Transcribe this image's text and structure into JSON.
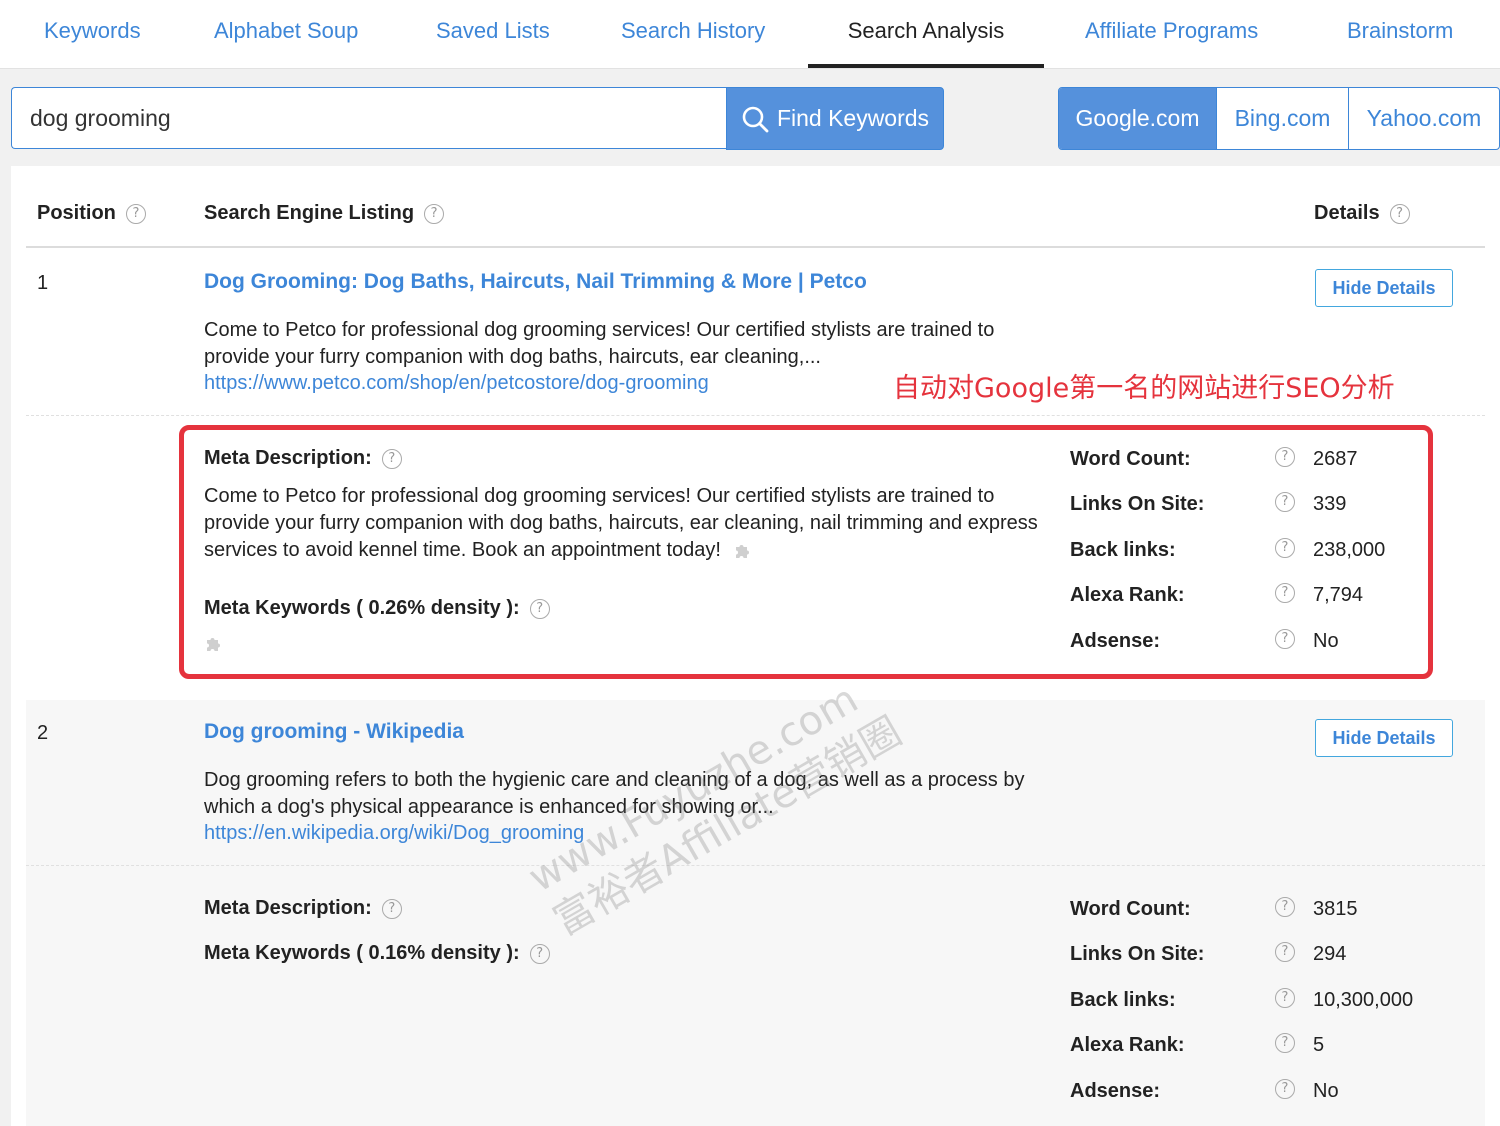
{
  "nav": {
    "tabs": [
      {
        "label": "Keywords"
      },
      {
        "label": "Alphabet Soup"
      },
      {
        "label": "Saved Lists"
      },
      {
        "label": "Search History"
      },
      {
        "label": "Search Analysis",
        "active": true
      },
      {
        "label": "Affiliate Programs"
      },
      {
        "label": "Brainstorm"
      }
    ]
  },
  "search": {
    "value": "dog grooming",
    "button_label": "Find Keywords"
  },
  "engines": [
    {
      "label": "Google.com",
      "selected": true
    },
    {
      "label": "Bing.com"
    },
    {
      "label": "Yahoo.com"
    }
  ],
  "table": {
    "col_position": "Position",
    "col_listing": "Search Engine Listing",
    "col_details": "Details"
  },
  "results": [
    {
      "position": "1",
      "title": "Dog Grooming: Dog Baths, Haircuts, Nail Trimming & More | Petco",
      "snippet": "Come to Petco for professional dog grooming services! Our certified stylists are trained to provide your furry companion with dog baths, haircuts, ear cleaning,...",
      "url": "https://www.petco.com/shop/en/petcostore/dog-grooming",
      "hide_label": "Hide Details",
      "meta_description_label": "Meta Description:",
      "meta_description": "Come to Petco for professional dog grooming services! Our certified stylists are trained to provide your furry companion with dog baths, haircuts, ear cleaning, nail trimming and express services to avoid kennel time. Book an appointment today!",
      "meta_keywords_label": "Meta Keywords ( 0.26% density ):",
      "stats": [
        {
          "label": "Word Count:",
          "value": "2687"
        },
        {
          "label": "Links On Site:",
          "value": "339"
        },
        {
          "label": "Back links:",
          "value": "238,000"
        },
        {
          "label": "Alexa Rank:",
          "value": "7,794"
        },
        {
          "label": "Adsense:",
          "value": "No"
        }
      ]
    },
    {
      "position": "2",
      "title": "Dog grooming - Wikipedia",
      "snippet": "Dog grooming refers to both the hygienic care and cleaning of a dog, as well as a process by which a dog's physical appearance is enhanced for showing or...",
      "url": "https://en.wikipedia.org/wiki/Dog_grooming",
      "hide_label": "Hide Details",
      "meta_description_label": "Meta Description:",
      "meta_keywords_label": "Meta Keywords ( 0.16% density ):",
      "stats": [
        {
          "label": "Word Count:",
          "value": "3815"
        },
        {
          "label": "Links On Site:",
          "value": "294"
        },
        {
          "label": "Back links:",
          "value": "10,300,000"
        },
        {
          "label": "Alexa Rank:",
          "value": "5"
        },
        {
          "label": "Adsense:",
          "value": "No"
        }
      ]
    }
  ],
  "annotation": {
    "text": "自动对Google第一名的网站进行SEO分析",
    "color": "#e5333d"
  },
  "watermark": {
    "line1": "www.Fuyuzhe.com",
    "line2": "富裕者Affiliate营销圈"
  },
  "colors": {
    "accent": "#3d86d8",
    "button_fill": "#5591dc"
  },
  "icons": {
    "search_button": "search-icon",
    "help": "question-circle-icon",
    "plugin": "puzzle-icon"
  }
}
